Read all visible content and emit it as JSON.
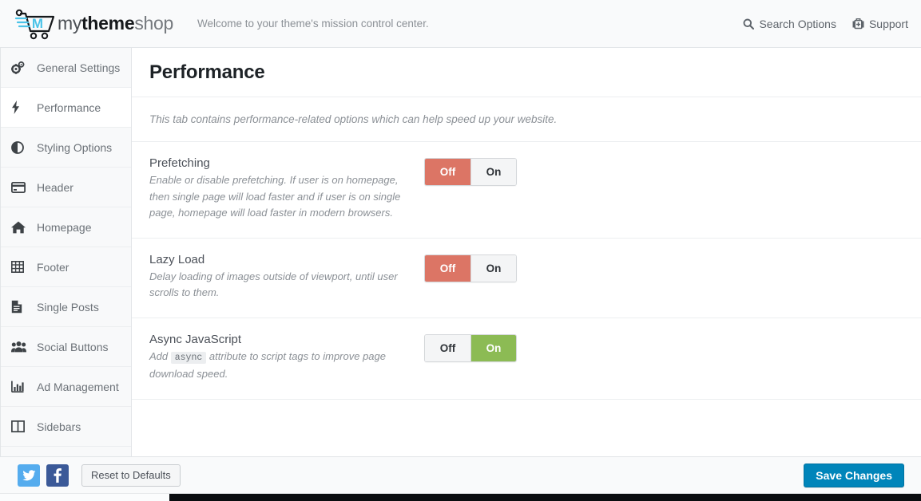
{
  "header": {
    "logo": {
      "icon": "shopping-cart-m-logo",
      "text_part1": "my",
      "text_part2": "theme",
      "text_part3": "shop"
    },
    "welcome": "Welcome to your theme's mission control center.",
    "links": [
      {
        "label": "Search Options",
        "icon": "search-icon"
      },
      {
        "label": "Support",
        "icon": "medkit-icon"
      }
    ]
  },
  "sidebar": {
    "items": [
      {
        "label": "General Settings",
        "icon": "gears-icon",
        "active": false
      },
      {
        "label": "Performance",
        "icon": "bolt-icon",
        "active": true
      },
      {
        "label": "Styling Options",
        "icon": "adjust-contrast-icon",
        "active": false
      },
      {
        "label": "Header",
        "icon": "credit-card-icon",
        "active": false
      },
      {
        "label": "Homepage",
        "icon": "home-icon",
        "active": false
      },
      {
        "label": "Footer",
        "icon": "table-grid-icon",
        "active": false
      },
      {
        "label": "Single Posts",
        "icon": "file-text-icon",
        "active": false
      },
      {
        "label": "Social Buttons",
        "icon": "users-group-icon",
        "active": false
      },
      {
        "label": "Ad Management",
        "icon": "bar-chart-icon",
        "active": false
      },
      {
        "label": "Sidebars",
        "icon": "columns-icon",
        "active": false
      }
    ]
  },
  "main": {
    "title": "Performance",
    "tab_description": "This tab contains performance-related options which can help speed up your website.",
    "options": [
      {
        "title": "Prefetching",
        "desc_pre": "Enable or disable prefetching. If user is on homepage, then single page will load faster and if user is on single page, homepage will load faster in modern browsers.",
        "code": "",
        "desc_post": "",
        "off_label": "Off",
        "on_label": "On",
        "selected": "Off"
      },
      {
        "title": "Lazy Load",
        "desc_pre": "Delay loading of images outside of viewport, until user scrolls to them.",
        "code": "",
        "desc_post": "",
        "off_label": "Off",
        "on_label": "On",
        "selected": "Off"
      },
      {
        "title": "Async JavaScript",
        "desc_pre": "Add ",
        "code": "async",
        "desc_post": " attribute to script tags to improve page download speed.",
        "off_label": "Off",
        "on_label": "On",
        "selected": "On"
      }
    ]
  },
  "footer": {
    "twitter_icon": "twitter-icon",
    "facebook_icon": "facebook-icon",
    "reset_label": "Reset to Defaults",
    "save_label": "Save Changes"
  },
  "colors": {
    "off_active": "#dc7565",
    "on_active": "#8cbb54",
    "save_blue": "#0085ba",
    "twitter": "#55acee",
    "facebook": "#3b5998",
    "logo_accent": "#4bc3e8"
  }
}
